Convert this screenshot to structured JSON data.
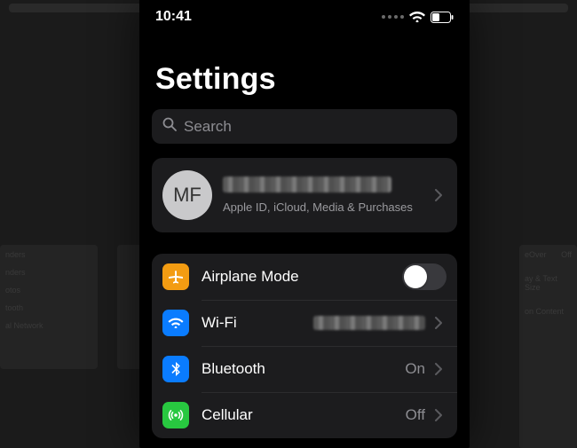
{
  "statusbar": {
    "time": "10:41"
  },
  "page_title": "Settings",
  "search": {
    "placeholder": "Search"
  },
  "account": {
    "initials": "MF",
    "name_redacted": true,
    "subtitle": "Apple ID, iCloud, Media & Purchases"
  },
  "rows": {
    "airplane": {
      "label": "Airplane Mode",
      "toggle_on": false
    },
    "wifi": {
      "label": "Wi-Fi",
      "value_redacted": true
    },
    "bluetooth": {
      "label": "Bluetooth",
      "value": "On"
    },
    "cellular": {
      "label": "Cellular",
      "value": "Off"
    }
  },
  "bg_right_items": [
    "eOver",
    "ay & Text Size",
    "on Content"
  ],
  "bg_right_values": [
    "Off",
    "",
    ""
  ],
  "bg_left_items": [
    "nders",
    "nders",
    "otos",
    "tooth",
    "al Network"
  ]
}
